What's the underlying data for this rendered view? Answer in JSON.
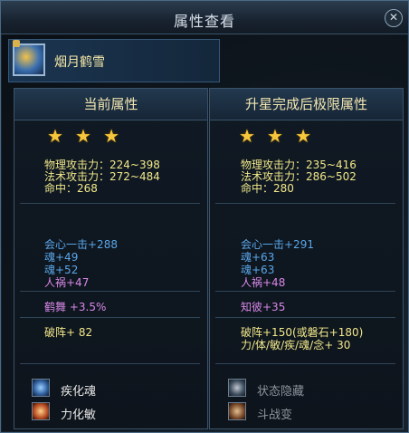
{
  "window": {
    "title": "属性查看"
  },
  "header": {
    "character_name": "烟月鹤雪"
  },
  "left": {
    "heading": "当前属性",
    "stars": [
      "★",
      "★",
      "★"
    ],
    "base": [
      "物理攻击力：224~398",
      "法术攻击力：272~484",
      "命中：268"
    ],
    "bonus_blue": [
      "会心一击+288",
      "魂+49",
      "魂+52"
    ],
    "bonus_pink": [
      "人祸+47"
    ],
    "extra": [
      "鹤舞 +3.5%"
    ],
    "po": [
      "破阵+ 82"
    ],
    "skills": [
      {
        "label": "疾化魂",
        "icon": "blue-rune-icon"
      },
      {
        "label": "力化敏",
        "icon": "fire-rune-icon"
      }
    ]
  },
  "right": {
    "heading": "升星完成后极限属性",
    "stars": [
      "★",
      "★",
      "★"
    ],
    "base": [
      "物理攻击力：235~416",
      "法术攻击力：286~502",
      "命中：280"
    ],
    "bonus_blue": [
      "会心一击+291",
      "魂+63",
      "魂+63"
    ],
    "bonus_pink": [
      "人祸+48"
    ],
    "extra": [
      "知彼+35"
    ],
    "po": [
      "破阵+150(或磐石+180)",
      "力/体/敏/疾/魂/念+ 30"
    ],
    "skills": [
      {
        "label": "状态隐藏",
        "icon": "ghost-rune-icon"
      },
      {
        "label": "斗战变",
        "icon": "fire-rune-icon"
      }
    ]
  }
}
